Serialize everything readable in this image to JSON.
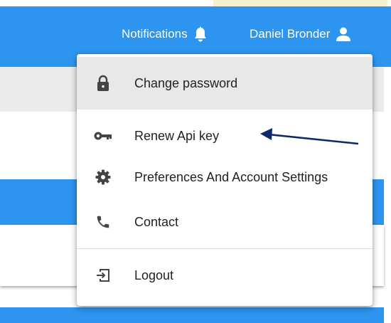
{
  "header": {
    "notifications_label": "Notifications",
    "user_name": "Daniel Bronder"
  },
  "menu": {
    "items": [
      {
        "label": "Change password",
        "icon": "lock-icon"
      },
      {
        "label": "Renew Api key",
        "icon": "key-icon"
      },
      {
        "label": "Preferences And Account Settings",
        "icon": "gear-icon"
      },
      {
        "label": "Contact",
        "icon": "phone-icon"
      },
      {
        "label": "Logout",
        "icon": "logout-icon"
      }
    ]
  },
  "colors": {
    "primary": "#2d95f0",
    "annotation_arrow": "#0f2a6b"
  }
}
